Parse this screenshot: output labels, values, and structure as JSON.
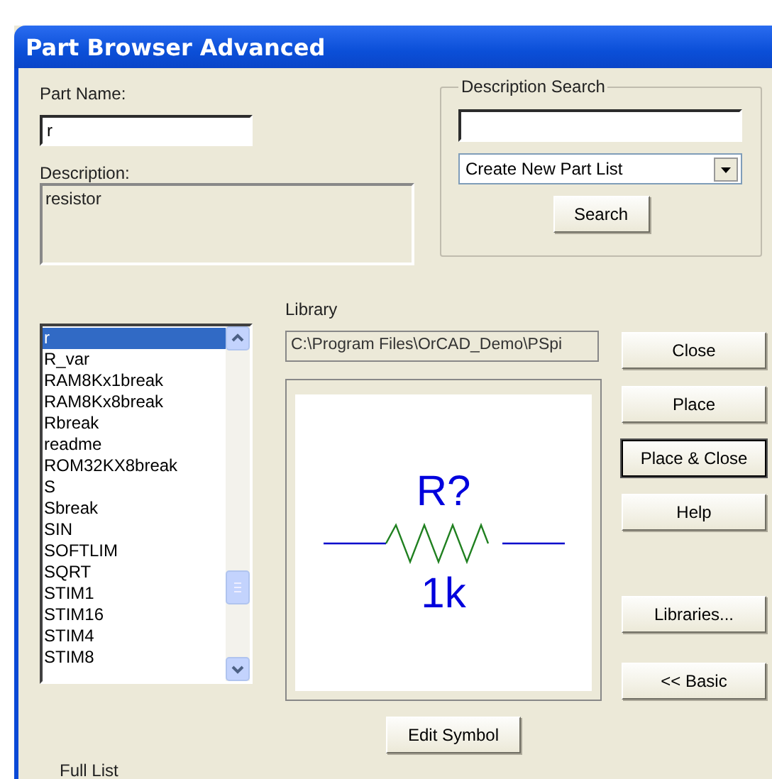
{
  "window": {
    "title": "Part Browser Advanced"
  },
  "part_name": {
    "label": "Part Name:",
    "value": "r"
  },
  "description": {
    "label": "Description:",
    "value": "resistor"
  },
  "description_search": {
    "title": "Description Search",
    "combo_value": "Create New Part List",
    "search_button": "Search"
  },
  "part_list": [
    {
      "name": "r",
      "selected": true
    },
    {
      "name": "R_var",
      "selected": false
    },
    {
      "name": "RAM8Kx1break",
      "selected": false
    },
    {
      "name": "RAM8Kx8break",
      "selected": false
    },
    {
      "name": "Rbreak",
      "selected": false
    },
    {
      "name": "readme",
      "selected": false
    },
    {
      "name": "ROM32KX8break",
      "selected": false
    },
    {
      "name": "S",
      "selected": false
    },
    {
      "name": "Sbreak",
      "selected": false
    },
    {
      "name": "SIN",
      "selected": false
    },
    {
      "name": "SOFTLIM",
      "selected": false
    },
    {
      "name": "SQRT",
      "selected": false
    },
    {
      "name": "STIM1",
      "selected": false
    },
    {
      "name": "STIM16",
      "selected": false
    },
    {
      "name": "STIM4",
      "selected": false
    },
    {
      "name": "STIM8",
      "selected": false
    }
  ],
  "library": {
    "label": "Library",
    "path": "C:\\Program Files\\OrCAD_Demo\\PSpi"
  },
  "symbol_preview": {
    "reference": "R?",
    "value": "1k"
  },
  "edit_symbol_button": "Edit Symbol",
  "buttons": [
    {
      "label": "Close",
      "default": false
    },
    {
      "label": "Place",
      "default": false
    },
    {
      "label": "Place & Close",
      "default": true
    },
    {
      "label": "Help",
      "default": false
    },
    {
      "label": "Libraries...",
      "default": false
    },
    {
      "label": "<< Basic",
      "default": false
    }
  ],
  "full_list_label": "Full List"
}
